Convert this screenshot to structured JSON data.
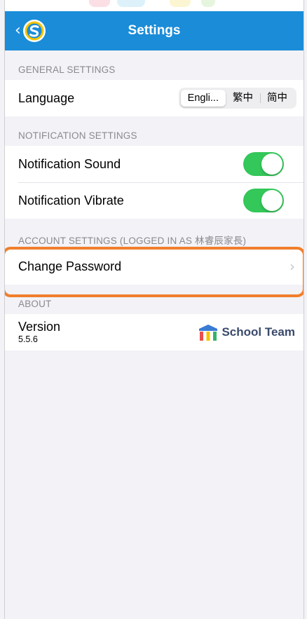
{
  "navbar": {
    "title": "Settings",
    "back_icon": "chevron-left-icon",
    "logo_icon": "app-logo-icon",
    "color": "#1a8cd8"
  },
  "general": {
    "header": "GENERAL SETTINGS",
    "language_label": "Language",
    "language_options": [
      "Engli...",
      "繁中",
      "简中"
    ],
    "language_selected_index": 0
  },
  "notification": {
    "header": "NOTIFICATION SETTINGS",
    "sound_label": "Notification Sound",
    "sound_on": true,
    "vibrate_label": "Notification Vibrate",
    "vibrate_on": true,
    "toggle_color": "#34c759"
  },
  "account": {
    "header": "ACCOUNT SETTINGS (LOGGED IN AS  林睿辰家長)",
    "change_password_label": "Change Password",
    "chevron_icon": "chevron-right-icon",
    "highlight_color": "#f07f2c"
  },
  "about": {
    "header": "ABOUT",
    "version_label": "Version",
    "version_number": "5.5.6",
    "brand_name": "School Team",
    "brand_icon": "school-team-logo-icon"
  }
}
